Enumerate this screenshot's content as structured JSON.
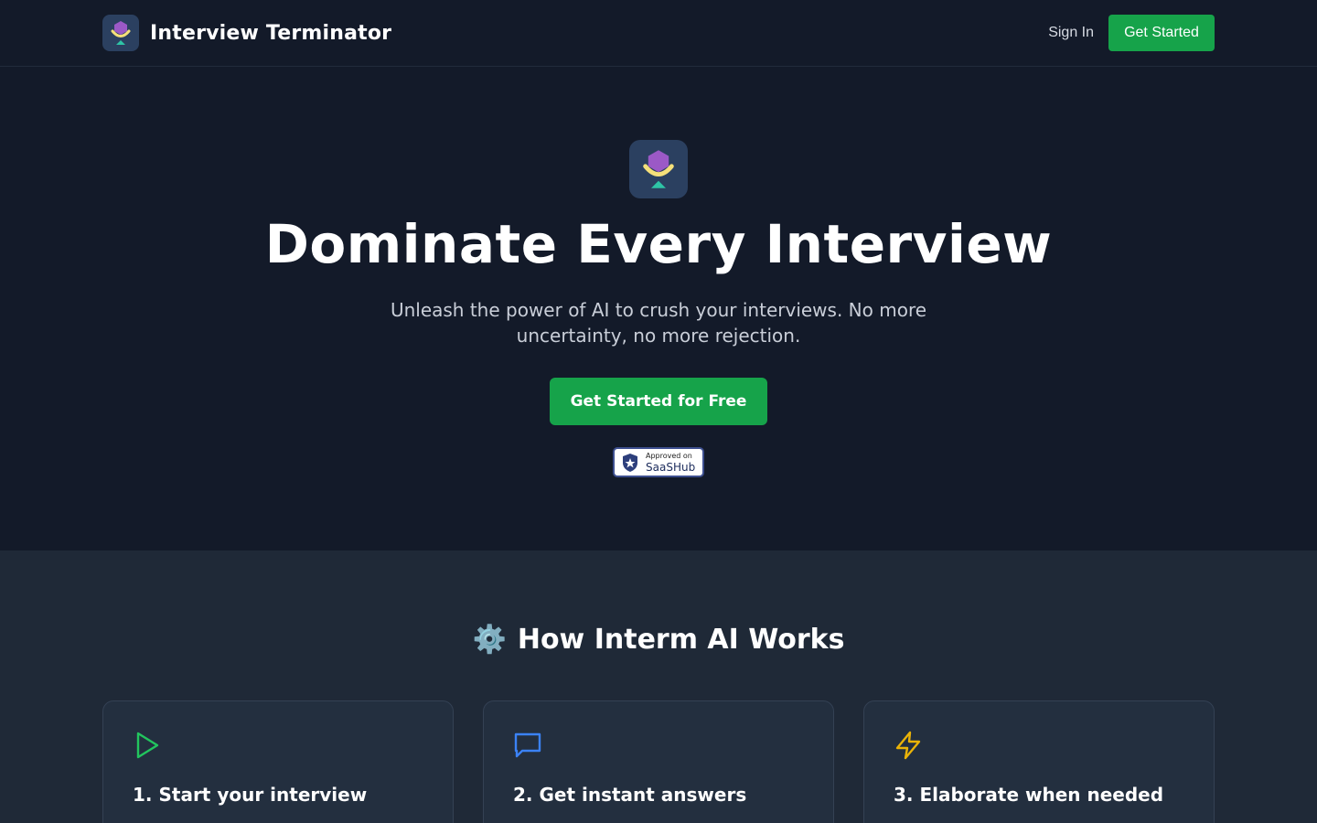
{
  "header": {
    "brand_name": "Interview Terminator",
    "sign_in_label": "Sign In",
    "get_started_label": "Get Started"
  },
  "hero": {
    "title": "Dominate Every Interview",
    "subtitle": "Unleash the power of AI to crush your interviews. No more uncertainty, no more rejection.",
    "cta_label": "Get Started for Free",
    "badge": {
      "small": "Approved on",
      "big": "SaaSHub"
    }
  },
  "how": {
    "title": "How Interm AI Works",
    "steps": [
      {
        "title": "1. Start your interview",
        "icon": "play-icon",
        "color": "#22c55e"
      },
      {
        "title": "2. Get instant answers",
        "icon": "message-icon",
        "color": "#3b82f6"
      },
      {
        "title": "3. Elaborate when needed",
        "icon": "lightning-icon",
        "color": "#eab308"
      }
    ]
  },
  "colors": {
    "background": "#131a29",
    "section_bg": "#1f2937",
    "accent": "#16a34a"
  }
}
